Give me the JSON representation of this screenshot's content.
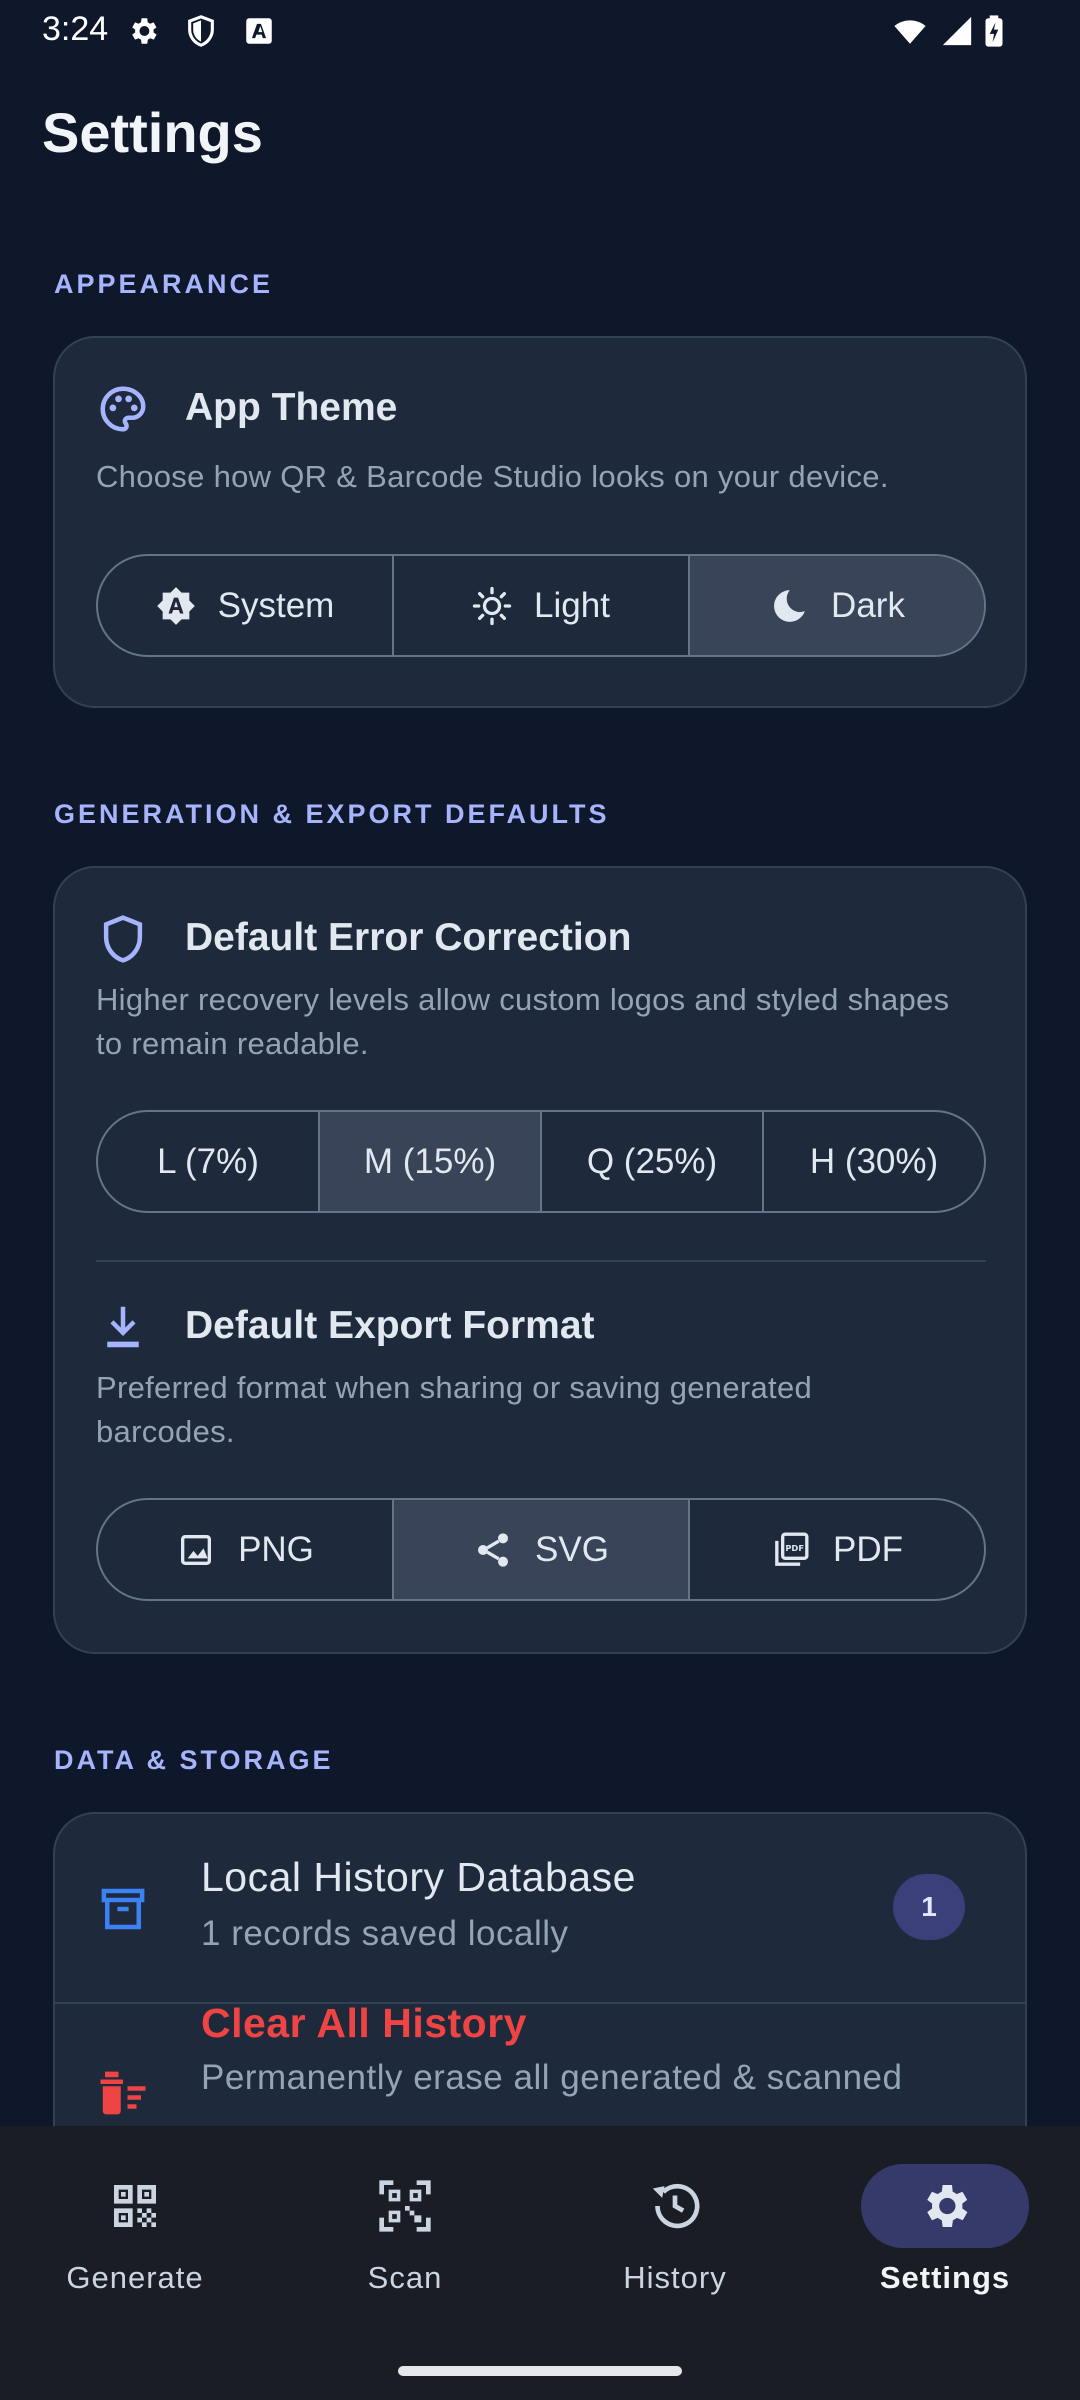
{
  "status_bar": {
    "time": "3:24",
    "icons": [
      "gear-icon",
      "shield-icon",
      "font-a-icon",
      "wifi-icon",
      "signal-icon",
      "battery-charging-icon"
    ]
  },
  "page": {
    "title": "Settings"
  },
  "appearance": {
    "section_label": "APPEARANCE",
    "theme": {
      "icon": "palette-icon",
      "title": "App Theme",
      "description": "Choose how QR & Barcode Studio looks on your device.",
      "options": [
        {
          "label": "System",
          "icon": "brightness-auto-icon",
          "selected": false
        },
        {
          "label": "Light",
          "icon": "sun-icon",
          "selected": false
        },
        {
          "label": "Dark",
          "icon": "moon-icon",
          "selected": true
        }
      ]
    }
  },
  "generation": {
    "section_label": "GENERATION & EXPORT DEFAULTS",
    "error_correction": {
      "icon": "shield-outline-icon",
      "title": "Default Error Correction",
      "description_line1": "Higher recovery levels allow custom logos and styled shapes",
      "description_line2": "to remain readable.",
      "options": [
        {
          "label": "L (7%)",
          "selected": false
        },
        {
          "label": "M (15%)",
          "selected": true
        },
        {
          "label": "Q (25%)",
          "selected": false
        },
        {
          "label": "H (30%)",
          "selected": false
        }
      ]
    },
    "export_format": {
      "icon": "download-icon",
      "title": "Default Export Format",
      "description_line1": "Preferred format when sharing or saving generated",
      "description_line2": "barcodes.",
      "options": [
        {
          "label": "PNG",
          "icon": "image-icon",
          "selected": false
        },
        {
          "label": "SVG",
          "icon": "share-icon",
          "selected": true
        },
        {
          "label": "PDF",
          "icon": "pdf-icon",
          "selected": false
        }
      ]
    }
  },
  "data_storage": {
    "section_label": "DATA & STORAGE",
    "history_db": {
      "icon": "archive-icon",
      "title": "Local History Database",
      "subtitle": "1 records saved locally",
      "count": "1"
    },
    "clear_history": {
      "icon": "delete-sweep-icon",
      "title": "Clear All History",
      "subtitle": "Permanently erase all generated & scanned"
    }
  },
  "bottom_nav": {
    "items": [
      {
        "label": "Generate",
        "icon": "qr-code-icon",
        "active": false
      },
      {
        "label": "Scan",
        "icon": "qr-scanner-icon",
        "active": false
      },
      {
        "label": "History",
        "icon": "history-icon",
        "active": false
      },
      {
        "label": "Settings",
        "icon": "settings-gear-icon",
        "active": true
      }
    ]
  },
  "colors": {
    "background": "#0f172a",
    "card": "#1e293b",
    "accent": "#a5b4fc",
    "danger": "#ef4444",
    "selected_segment": "#3a4458",
    "active_nav_pill": "#363a6b"
  }
}
